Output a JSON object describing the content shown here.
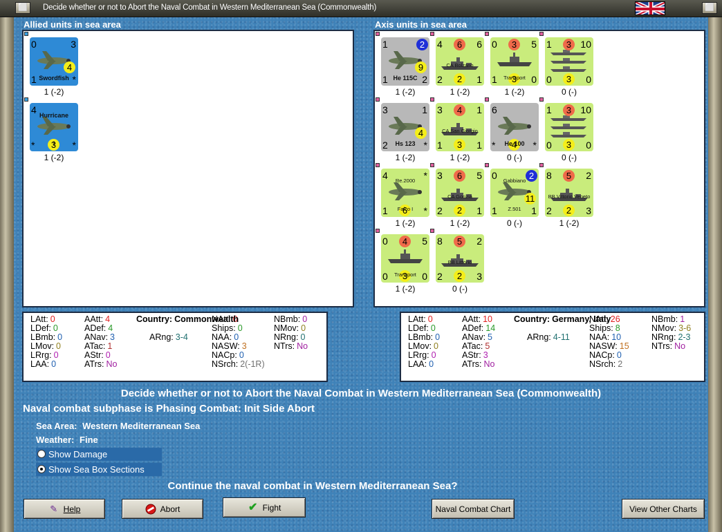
{
  "window": {
    "title": "Decide whether or not to Abort the Naval Combat in Western Mediterranean Sea (Commonwealth)"
  },
  "titlebar_buttons": {
    "left": "⬜",
    "right": "⬜"
  },
  "headers": {
    "allied": "Allied units in sea area",
    "axis": "Axis units in sea area"
  },
  "allied_units": [
    {
      "tl": "0",
      "tr": "3",
      "circle": "4",
      "circle_color": "yel",
      "name": "Swordfish",
      "bl": "1",
      "br": "*",
      "caption": "1 (-2)"
    },
    {
      "tl": "4",
      "tr": "",
      "name": "Hurricane",
      "name2": "I",
      "bl": "*",
      "br": "*",
      "bottom_circle": "3",
      "caption": "1 (-2)"
    }
  ],
  "axis_units": [
    {
      "tl": "1",
      "tr_circle": "2",
      "mid_circle": "9",
      "name": "He 115C",
      "bl": "1",
      "br": "2",
      "caption": "1 (-2)"
    },
    {
      "tl": "4",
      "top_circle": "6",
      "tr": "6",
      "name": "CA Bolzano",
      "bl": "2",
      "bottom_circle": "2",
      "br": "1",
      "caption": "1 (-2)"
    },
    {
      "tl": "0",
      "top_circle": "3",
      "tr": "5",
      "name": "Transport",
      "bl": "1",
      "bottom_circle": "3",
      "br": "0",
      "caption": "1 (-2)"
    },
    {
      "tl": "1",
      "top_circle": "3",
      "tr": "10",
      "name": "",
      "bl": "0",
      "bottom_circle": "3",
      "br": "0",
      "caption": "0 (-)"
    },
    {
      "tl": "3",
      "tr": "1",
      "mid_circle": "4",
      "name": "Hs 123",
      "bl": "2",
      "br": "*",
      "caption": "1 (-2)"
    },
    {
      "tl": "3",
      "top_circle": "4",
      "tr": "1",
      "name": "CA San Giorgio",
      "bl": "1",
      "bottom_circle": "3",
      "br": "1",
      "caption": "1 (-2)"
    },
    {
      "tl": "6",
      "tr": "",
      "name": "He 100",
      "bl": "*",
      "bottom_circle": "4",
      "br": "*",
      "caption": "0 (-)"
    },
    {
      "tl": "1",
      "top_circle": "3",
      "tr": "10",
      "name": "",
      "bl": "0",
      "bottom_circle": "3",
      "br": "0",
      "caption": "0 (-)"
    },
    {
      "tl": "4",
      "tr": "*",
      "name": "Re.2000",
      "name2": "Falco I",
      "bl": "1",
      "bottom_circle": "6",
      "br": "*",
      "caption": "1 (-2)"
    },
    {
      "tl": "3",
      "top_circle": "6",
      "tr": "5",
      "name": "CA Gorizia",
      "bl": "2",
      "bottom_circle": "2",
      "br": "1",
      "caption": "1 (-2)"
    },
    {
      "tl": "0",
      "tr_circle": "2",
      "mid_circle": "11",
      "name": "Gabbiano",
      "name2": "Z.501",
      "bl": "1",
      "br": "1",
      "caption": "0 (-)"
    },
    {
      "tl": "8",
      "top_circle": "5",
      "tr": "2",
      "name": "BB Vittorio Veneto",
      "bl": "2",
      "bottom_circle": "2",
      "br": "3",
      "caption": "1 (-2)"
    },
    {
      "tl": "0",
      "top_circle": "4",
      "tr": "5",
      "name": "Transport",
      "bl": "0",
      "bottom_circle": "3",
      "br": "0",
      "caption": "1 (-2)"
    },
    {
      "tl": "8",
      "top_circle": "5",
      "tr": "2",
      "name": "BB Littorio",
      "bl": "2",
      "bottom_circle": "2",
      "br": "3",
      "caption": "0 (-)"
    }
  ],
  "allied_stats": {
    "LAtt": "0",
    "LDef": "0",
    "LBmb": "0",
    "LMov": "0",
    "LRrg": "0",
    "LAA": "0",
    "AAtt": "4",
    "ADef": "4",
    "ANav": "3",
    "ATac": "1",
    "AStr": "0",
    "ATrs": "No",
    "country_label": "Country:",
    "country": "Commonwealth",
    "ARng": "3-4",
    "NAtt": "0",
    "Ships": "0",
    "NAA": "0",
    "NASW": "3",
    "NACp": "0",
    "NSrch": "2(-1R)",
    "NBmb": "0",
    "NMov": "0",
    "NRng": "0",
    "NTrs": "No"
  },
  "axis_stats": {
    "LAtt": "0",
    "LDef": "0",
    "LBmb": "0",
    "LMov": "0",
    "LRrg": "0",
    "LAA": "0",
    "AAtt": "10",
    "ADef": "14",
    "ANav": "5",
    "ATac": "5",
    "AStr": "3",
    "ATrs": "No",
    "country_label": "Country:",
    "country": "Germany, Italy",
    "ARng": "4-11",
    "NAtt": "26",
    "Ships": "8",
    "NAA": "10",
    "NASW": "15",
    "NACp": "0",
    "NSrch": "2",
    "NBmb": "1",
    "NMov": "3-6",
    "NRng": "2-3",
    "NTrs": "No"
  },
  "messages": {
    "headline": "Decide whether or not to Abort the Naval Combat in Western Mediterranean Sea (Commonwealth)",
    "subphase": "Naval combat subphase is Phasing Combat: Init Side Abort",
    "sea_area_label": "Sea Area:",
    "sea_area": "Western Mediterranean Sea",
    "weather_label": "Weather:",
    "weather": "Fine",
    "question": "Continue the naval combat in Western Mediterranean Sea?"
  },
  "options": {
    "show_damage": "Show Damage",
    "show_sea_box": "Show Sea Box Sections"
  },
  "buttons": {
    "help": "Help",
    "abort": "Abort",
    "fight": "Fight",
    "naval_chart": "Naval Combat Chart",
    "other_charts": "View Other Charts"
  },
  "colors": {
    "sea": "#3f82b8",
    "allied_counter": "#2e8ad6",
    "axis_counter": "#c9ec7c",
    "aircraft_counter": "#b8b8b8",
    "red_value": "#e02020",
    "green_value": "#2a9a2a"
  }
}
